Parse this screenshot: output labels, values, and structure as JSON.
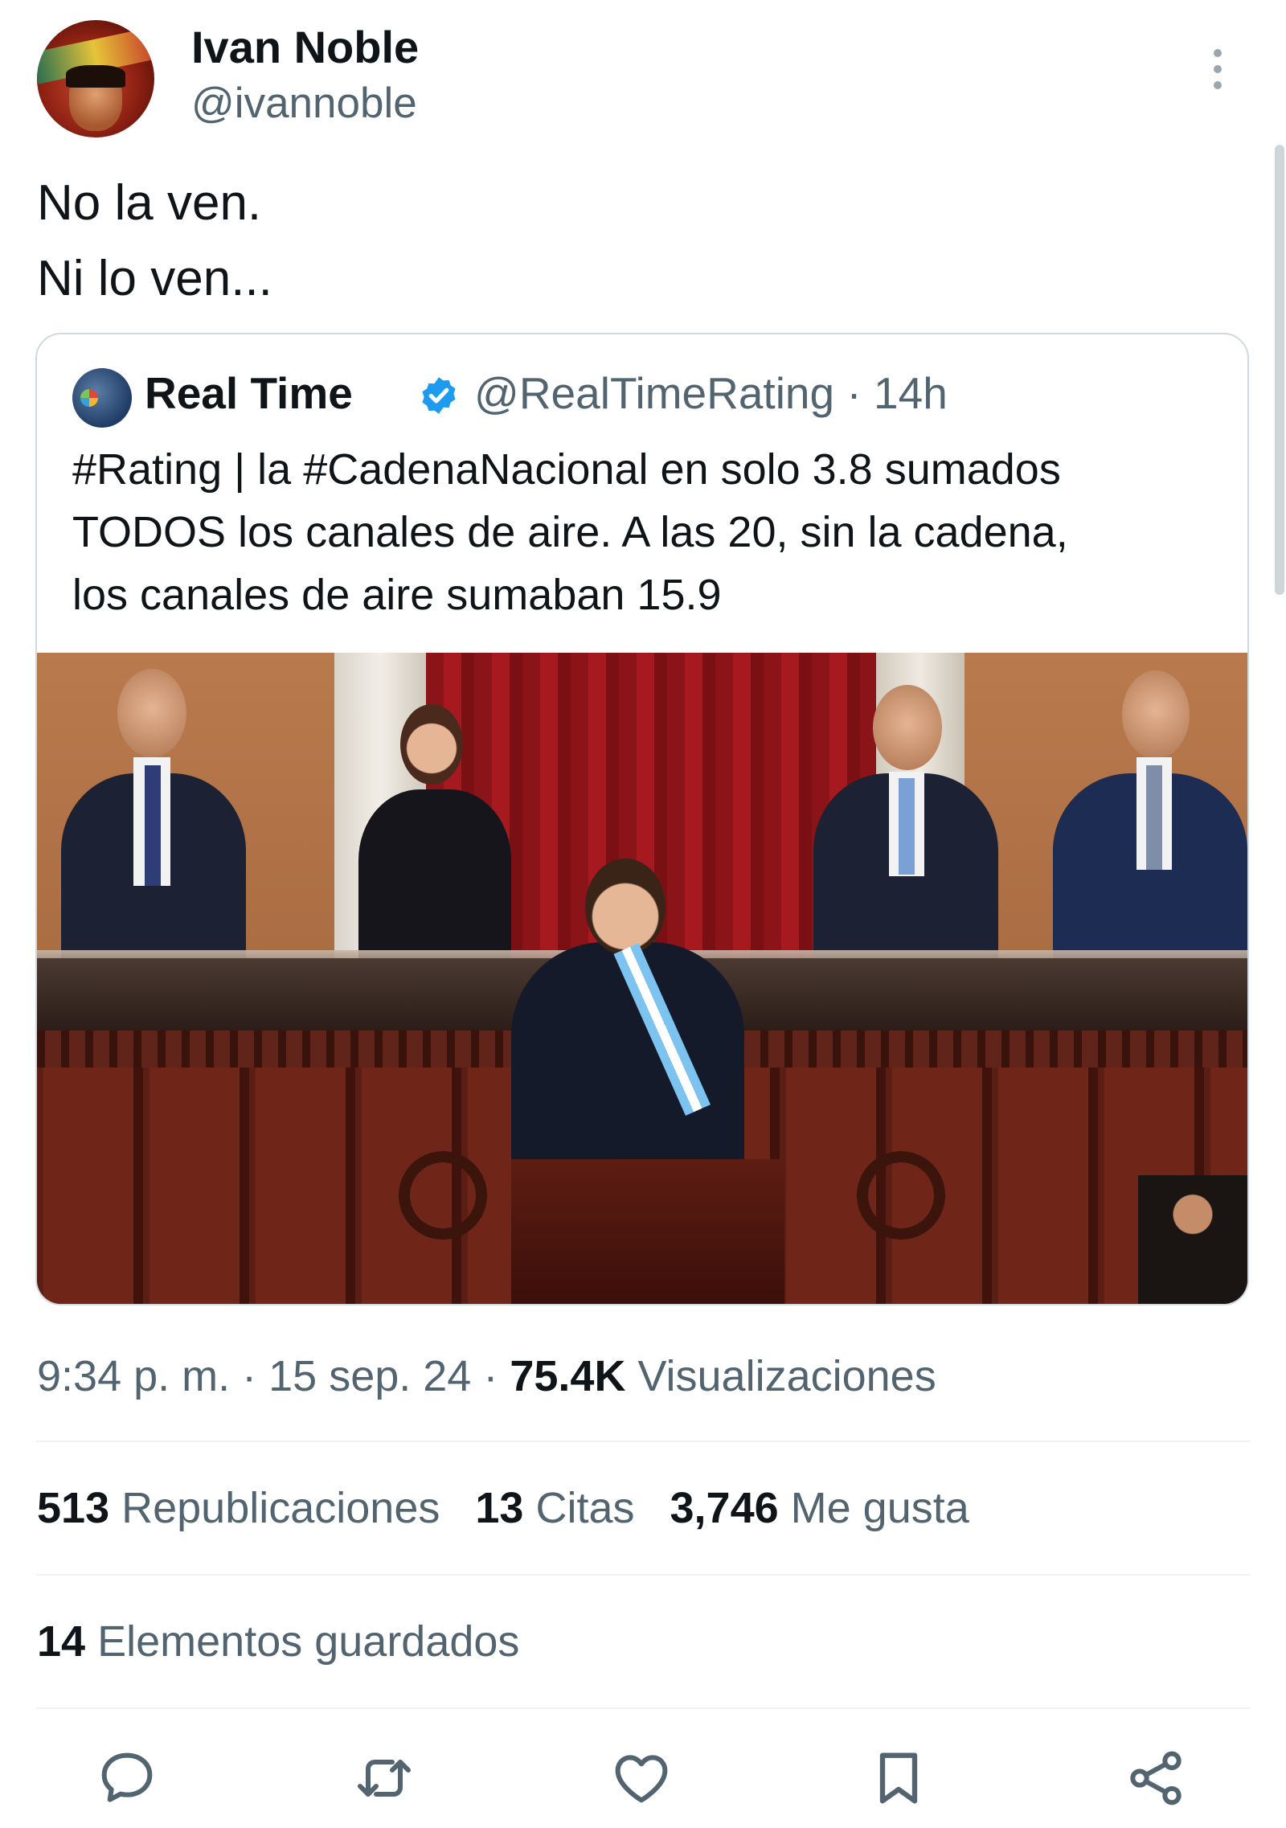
{
  "author": {
    "display_name": "Ivan Noble",
    "handle": "@ivannoble"
  },
  "tweet": {
    "lines": [
      "No la ven.",
      "Ni lo ven..."
    ]
  },
  "quoted": {
    "display_name": "Real Time",
    "handle": "@RealTimeRating",
    "separator": " · ",
    "age": "14h",
    "text_lines": [
      "#Rating | la #CadenaNacional en solo 3.8 sumados",
      "TODOS los canales de aire. A las 20, sin la cadena,",
      "los canales de aire sumaban 15.9"
    ]
  },
  "meta": {
    "time": "9:34 p. m.",
    "date": "15 sep. 24",
    "separator": " · ",
    "views_count": "75.4K",
    "views_label": "Visualizaciones"
  },
  "stats": {
    "reposts_count": "513",
    "reposts_label": "Republicaciones",
    "quotes_count": "13",
    "quotes_label": "Citas",
    "likes_count": "3,746",
    "likes_label": "Me gusta",
    "bookmarks_count": "14",
    "bookmarks_label": "Elementos guardados"
  },
  "actions": {
    "icons": [
      "reply-icon",
      "repost-icon",
      "like-icon",
      "bookmark-icon",
      "share-icon"
    ]
  },
  "colors": {
    "text_primary": "#0f1419",
    "text_secondary": "#536471",
    "border": "#cfd9de",
    "verified": "#1d9bf0"
  }
}
